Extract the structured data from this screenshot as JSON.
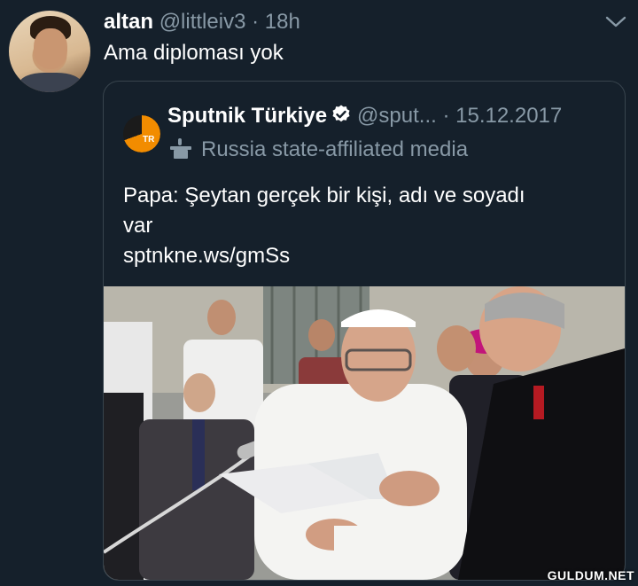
{
  "tweet": {
    "author_name": "altan",
    "author_handle": "@littleiv3",
    "separator": "·",
    "time": "18h",
    "text": "Ama diploması yok"
  },
  "quoted_tweet": {
    "author_name": "Sputnik Türkiye",
    "author_handle": "@sput...",
    "separator": "·",
    "date": "15.12.2017",
    "label": "Russia state-affiliated media",
    "avatar_badge": "TR",
    "text_lines": [
      "Papa: Şeytan gerçek bir kişi, adı ve soyadı",
      "var"
    ],
    "link": "sptnkne.ws/gmSs"
  },
  "watermark": "GULDUM.NET",
  "colors": {
    "background": "#15202b",
    "secondary_text": "#8899a6",
    "border": "#38444d",
    "verified": "#ffffff",
    "brand_orange": "#f28c00"
  },
  "icons": {
    "menu": "chevron-down-icon",
    "verified": "verified-badge-icon",
    "state_media": "podium-icon"
  }
}
